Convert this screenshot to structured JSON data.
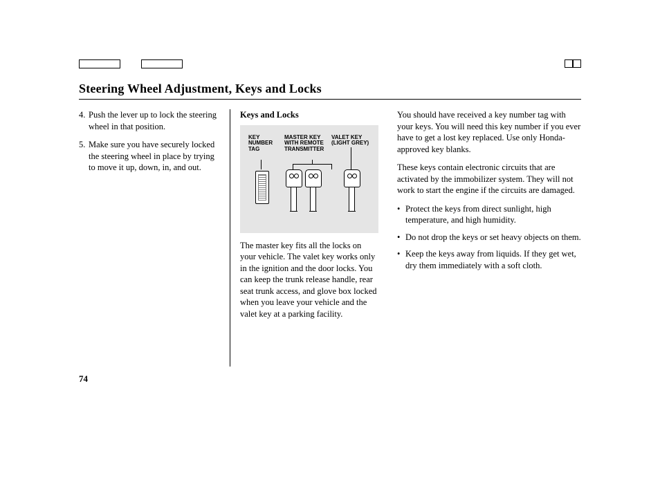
{
  "title": "Steering Wheel Adjustment, Keys and Locks",
  "page_number": "74",
  "col1": {
    "items": [
      {
        "num": "4.",
        "text": "Push the lever up to lock the steering wheel in that position."
      },
      {
        "num": "5.",
        "text": "Make sure you have securely locked the steering wheel in place by trying to move it up, down, in, and out."
      }
    ]
  },
  "col2": {
    "heading": "Keys and Locks",
    "figure": {
      "label_tag": "KEY NUMBER TAG",
      "label_master": "MASTER KEY WITH REMOTE TRANSMITTER",
      "label_valet": "VALET KEY (LIGHT GREY)"
    },
    "para": "The master key fits all the locks on your vehicle. The valet key works only in the ignition and the door locks. You can keep the trunk release handle, rear seat trunk access, and glove box locked when you leave your vehicle and the valet key at a parking facility."
  },
  "col3": {
    "para1": "You should have received a key number tag with your keys. You will need this key number if you ever have to get a lost key replaced. Use only Honda-approved key blanks.",
    "para2": "These keys contain electronic circuits that are activated by the immobilizer system. They will not work to start the engine if the circuits are damaged.",
    "bullets": [
      "Protect the keys from direct sunlight, high temperature, and high humidity.",
      "Do not drop the keys or set heavy objects on them.",
      "Keep the keys away from liquids. If they get wet, dry them immediately with a soft cloth."
    ]
  }
}
